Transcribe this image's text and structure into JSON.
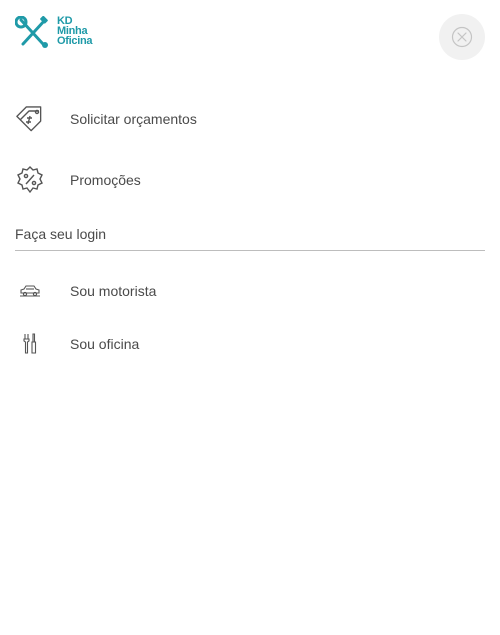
{
  "brand": {
    "logo_line1": "KD",
    "logo_line2": "Minha",
    "logo_line3": "Oficina",
    "color": "#1f9aa8"
  },
  "header": {
    "close_icon": "close-circle-icon"
  },
  "menu": {
    "items": [
      {
        "label": "Solicitar orçamentos",
        "icon": "price-tags-icon"
      },
      {
        "label": "Promoções",
        "icon": "percent-badge-icon"
      }
    ]
  },
  "login": {
    "title": "Faça seu login",
    "items": [
      {
        "label": "Sou motorista",
        "icon": "car-icon"
      },
      {
        "label": "Sou oficina",
        "icon": "tools-icon"
      }
    ]
  },
  "colors": {
    "accent": "#1f9aa8",
    "text": "#4a4a4a",
    "icon": "#555555",
    "close_bg": "#f1f1f1",
    "divider": "#bdbdbd"
  }
}
